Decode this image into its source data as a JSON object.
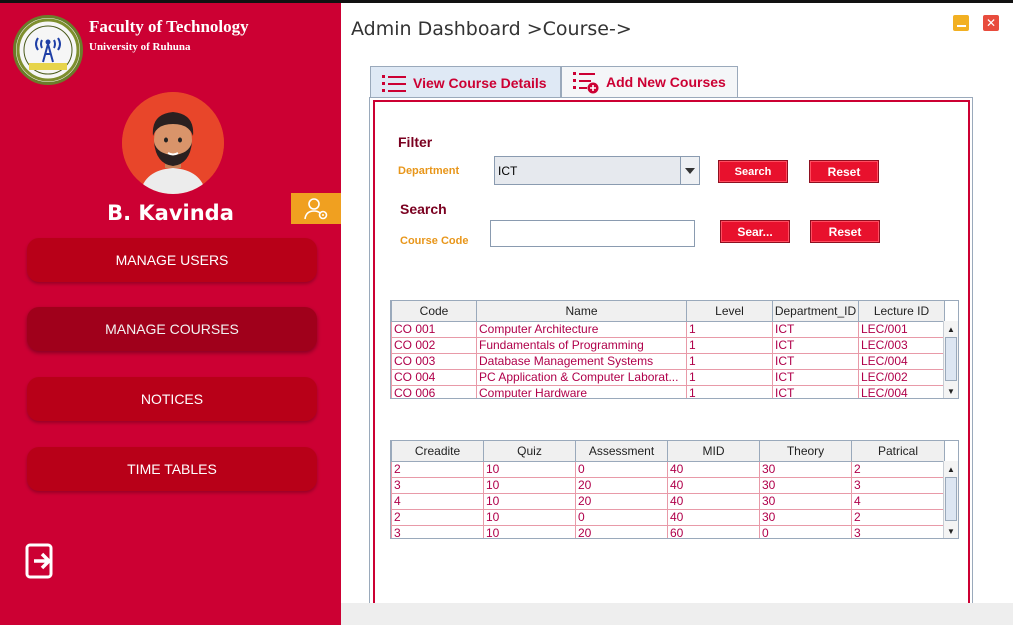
{
  "sidebar": {
    "org_title": "Faculty of Technology",
    "org_subtitle": "University of Ruhuna",
    "user_name": "B. Kavinda",
    "nav": [
      {
        "label": "MANAGE USERS"
      },
      {
        "label": "MANAGE COURSES"
      },
      {
        "label": "NOTICES"
      },
      {
        "label": "TIME TABLES"
      }
    ],
    "logo_text": "Faculty of Technology",
    "colors": {
      "background": "#cc0033",
      "button": "#b80018",
      "profile_button": "#f0a020"
    },
    "icons": {
      "profile": "user-settings-icon",
      "logout": "logout-icon"
    }
  },
  "header": {
    "breadcrumb": "Admin Dashboard >Course->"
  },
  "tabs": [
    {
      "label": "View Course Details",
      "icon": "list-icon",
      "active": true
    },
    {
      "label": "Add New Courses",
      "icon": "add-list-icon",
      "active": false
    }
  ],
  "filter": {
    "heading": "Filter",
    "department_label": "Department",
    "department_value": "ICT",
    "search_label": "Search",
    "reset_label": "Reset"
  },
  "search": {
    "heading": "Search",
    "course_code_label": "Course Code",
    "course_code_value": "",
    "search_label": "Sear...",
    "reset_label": "Reset"
  },
  "course_table": {
    "columns": [
      "Code",
      "Name",
      "Level",
      "Department_ID",
      "Lecture ID"
    ],
    "rows": [
      [
        "CO 001",
        "Computer Architecture",
        "1",
        "ICT",
        "LEC/001"
      ],
      [
        "CO 002",
        "Fundamentals of Programming",
        "1",
        "ICT",
        "LEC/003"
      ],
      [
        "CO 003",
        "Database Management Systems",
        "1",
        "ICT",
        "LEC/004"
      ],
      [
        "CO 004",
        "PC Application & Computer Laborat...",
        "1",
        "ICT",
        "LEC/002"
      ],
      [
        "CO 006",
        "Computer Hardware",
        "1",
        "ICT",
        "LEC/004"
      ]
    ]
  },
  "marks_table": {
    "columns": [
      "Creadite",
      "Quiz",
      "Assessment",
      "MID",
      "Theory",
      "Patrical"
    ],
    "rows": [
      [
        "2",
        "10",
        "0",
        "40",
        "30",
        "2"
      ],
      [
        "3",
        "10",
        "20",
        "40",
        "30",
        "3"
      ],
      [
        "4",
        "10",
        "20",
        "40",
        "30",
        "4"
      ],
      [
        "2",
        "10",
        "0",
        "40",
        "30",
        "2"
      ],
      [
        "3",
        "10",
        "20",
        "60",
        "0",
        "3"
      ]
    ]
  },
  "colors": {
    "accent": "#cc0033",
    "label_orange": "#e8961a",
    "cell_text": "#b0004a",
    "button_red": "#e8112d"
  }
}
